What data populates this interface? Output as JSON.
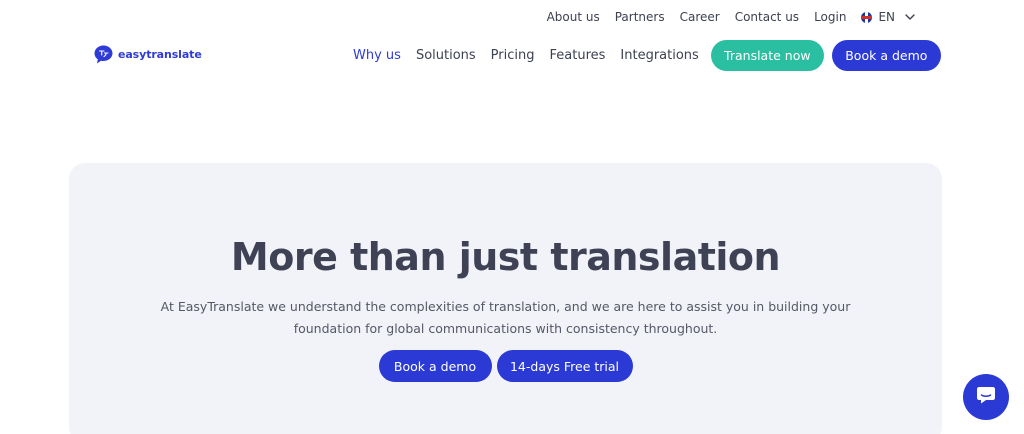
{
  "topbar": {
    "links": [
      "About us",
      "Partners",
      "Career",
      "Contact us",
      "Login"
    ],
    "language": "EN"
  },
  "brand": {
    "logo_text": "easytranslate",
    "accent": "#2f3bd6"
  },
  "nav": {
    "links": [
      "Why us",
      "Solutions",
      "Pricing",
      "Features",
      "Integrations"
    ],
    "active": "Why us",
    "translate_now": "Translate now",
    "book_demo": "Book a demo"
  },
  "hero": {
    "title": "More than just translation",
    "subtitle_line1": "At EasyTranslate we understand the complexities of translation, and we are here to assist you in building your",
    "subtitle_line2": "foundation for global communications with consistency throughout.",
    "book_demo": "Book a demo",
    "free_trial": "14-days Free trial"
  },
  "colors": {
    "primary": "#2b39d5",
    "teal": "#2bbfa1",
    "hero_bg": "#f1f3f8",
    "text": "#3f4254"
  },
  "icons": {
    "language_flag": "uk-flag-icon",
    "language_dropdown": "chevron-down-icon",
    "logo": "chat-bubble-logo-icon",
    "chat": "chat-bubble-icon"
  }
}
